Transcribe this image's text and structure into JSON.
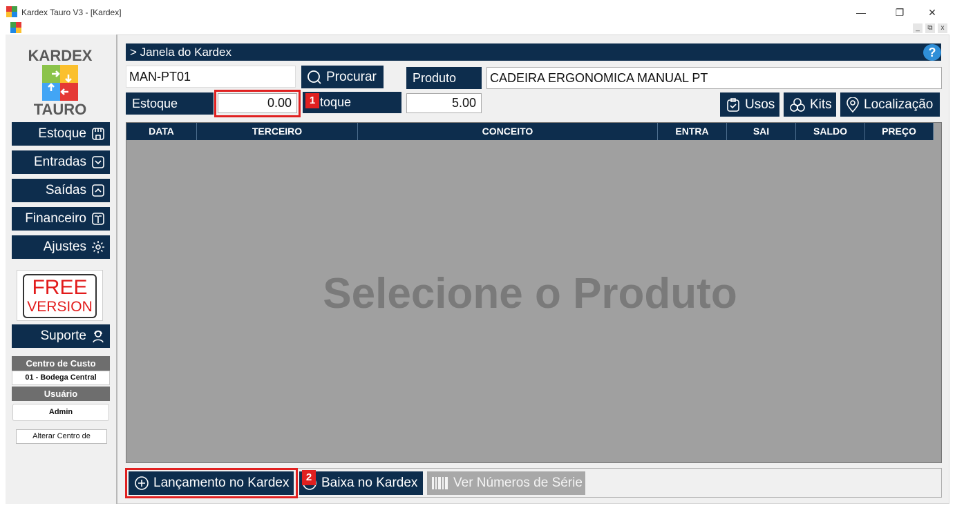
{
  "window": {
    "title": "Kardex Tauro V3 - [Kardex]",
    "minimize": "—",
    "maximize": "❐",
    "close": "✕",
    "mdi_minimize": "_",
    "mdi_restore": "⧉",
    "mdi_close": "x"
  },
  "brand": {
    "top": "KARDEX",
    "bottom": "TAURO"
  },
  "sidebar": {
    "items": [
      {
        "label": "Estoque",
        "icon": "store-icon"
      },
      {
        "label": "Entradas",
        "icon": "inbox-in-icon"
      },
      {
        "label": "Saídas",
        "icon": "inbox-out-icon"
      },
      {
        "label": "Financeiro",
        "icon": "book-icon"
      },
      {
        "label": "Ajustes",
        "icon": "gear-icon"
      }
    ],
    "free_line1": "FREE",
    "free_line2": "VERSION",
    "support_label": "Suporte",
    "centro_custo_title": "Centro de Custo",
    "centro_custo_value": "01 - Bodega Central",
    "usuario_title": "Usuário",
    "usuario_value": "Admin",
    "alterar_label": "Alterar Centro de"
  },
  "header": {
    "title": "> Janela do Kardex",
    "help": "?"
  },
  "search": {
    "code_value": "MAN-PT01",
    "procurar_label": "Procurar",
    "produto_label": "Produto",
    "produto_value": "CADEIRA ERGONOMICA MANUAL PT"
  },
  "stock": {
    "estoque_label": "Estoque",
    "estoque_value": "0.00",
    "min_label": "toque",
    "min_value": "5.00",
    "usos_label": "Usos",
    "kits_label": "Kits",
    "localizacao_label": "Localização"
  },
  "markers": {
    "m1": "1",
    "m2": "2"
  },
  "table": {
    "columns": [
      "DATA",
      "TERCEIRO",
      "CONCEITO",
      "ENTRA",
      "SAI",
      "SALDO",
      "PREÇO"
    ],
    "empty_message": "Selecione o Produto"
  },
  "actions": {
    "lancamento_label": "Lançamento no Kardex",
    "baixa_label": "Baixa no Kardex",
    "serie_label": "Ver Números de Série"
  },
  "colors": {
    "navy": "#0d2d4d",
    "highlight_red": "#e02020",
    "table_bg": "#a0a0a0",
    "free_red": "#e21b1b"
  }
}
